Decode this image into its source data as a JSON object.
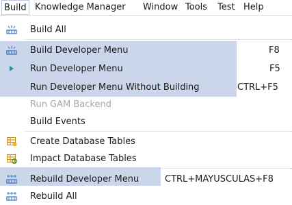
{
  "menubar": {
    "items": [
      {
        "label": "Build"
      },
      {
        "label": "Knowledge Manager"
      },
      {
        "label": "Window"
      },
      {
        "label": "Tools"
      },
      {
        "label": "Test"
      },
      {
        "label": "Help"
      }
    ]
  },
  "menu": {
    "items": [
      {
        "label": "Build All",
        "shortcut": "",
        "icon": "build-icon",
        "highlighted": false,
        "enabled": true
      },
      {
        "label": "Build Developer Menu",
        "shortcut": "F8",
        "icon": "build-icon",
        "highlighted": true,
        "enabled": true
      },
      {
        "label": "Run Developer Menu",
        "shortcut": "F5",
        "icon": "run-icon",
        "highlighted": true,
        "enabled": true
      },
      {
        "label": "Run Developer Menu Without Building",
        "shortcut": "CTRL+F5",
        "icon": "",
        "highlighted": true,
        "enabled": true
      },
      {
        "label": "Run GAM Backend",
        "shortcut": "",
        "icon": "",
        "highlighted": false,
        "enabled": false
      },
      {
        "label": "Build Events",
        "shortcut": "",
        "icon": "",
        "highlighted": false,
        "enabled": true
      },
      {
        "label": "Create Database Tables",
        "shortcut": "",
        "icon": "create-tables-icon",
        "highlighted": false,
        "enabled": true
      },
      {
        "label": "Impact Database Tables",
        "shortcut": "",
        "icon": "impact-tables-icon",
        "highlighted": false,
        "enabled": true
      },
      {
        "label": "Rebuild Developer Menu",
        "shortcut": "CTRL+MAYUSCULAS+F8",
        "icon": "rebuild-icon",
        "highlighted": true,
        "enabled": true
      },
      {
        "label": "Rebuild All",
        "shortcut": "",
        "icon": "rebuild-icon",
        "highlighted": false,
        "enabled": true
      }
    ]
  },
  "colors": {
    "highlight": "#cbd6ea",
    "disabled_text": "#a8a8a8",
    "run_icon": "#1e8fa8"
  }
}
